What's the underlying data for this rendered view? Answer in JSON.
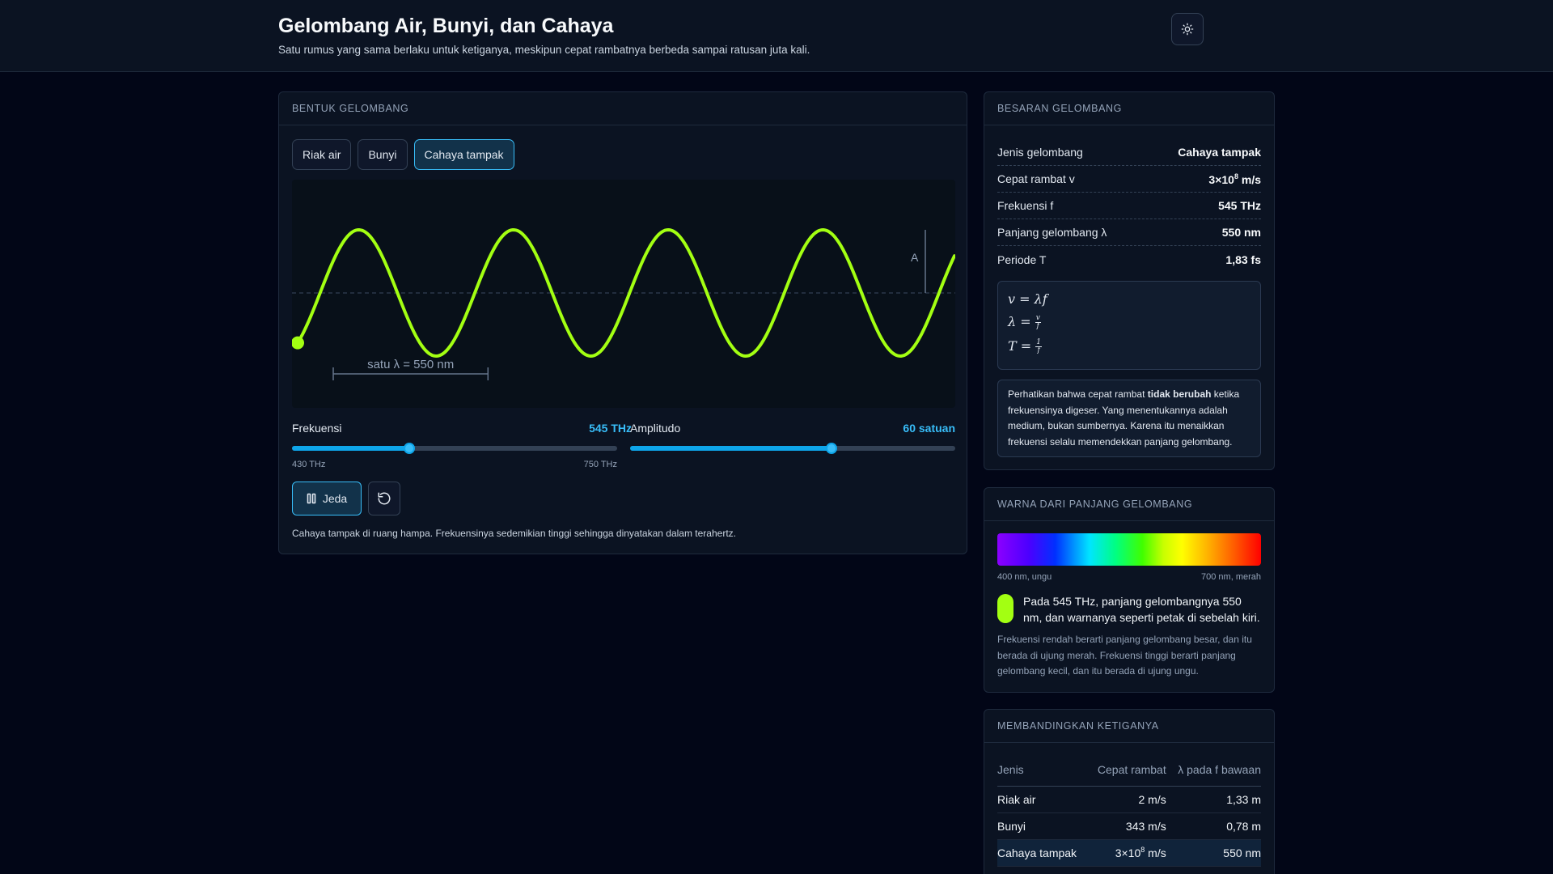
{
  "header": {
    "title": "Gelombang Air, Bunyi, dan Cahaya",
    "subtitle": "Satu rumus yang sama berlaku untuk ketiganya, meskipun cepat rambatnya berbeda sampai ratusan juta kali.",
    "theme_icon": "sun-icon"
  },
  "wave_panel": {
    "heading": "BENTUK GELOMBANG",
    "tabs": [
      {
        "label": "Riak air",
        "active": false
      },
      {
        "label": "Bunyi",
        "active": false
      },
      {
        "label": "Cahaya tampak",
        "active": true
      }
    ],
    "canvas": {
      "wave_color": "#a3ff12",
      "cycles_visible": 4.25,
      "wavelength_label": "satu λ = 550 nm",
      "amplitude_label": "A"
    },
    "frequency": {
      "label": "Frekuensi",
      "value": "545 THz",
      "min": "430 THz",
      "max": "750 THz",
      "fraction": 0.36
    },
    "amplitude": {
      "label": "Amplitudo",
      "value": "60 satuan",
      "fraction": 0.62
    },
    "pause_label": "Jeda",
    "pause_icon": "pause-icon",
    "reset_icon": "reset-icon",
    "caption": "Cahaya tampak di ruang hampa. Frekuensinya sedemikian tinggi sehingga dinyatakan dalam terahertz."
  },
  "properties": {
    "heading": "BESARAN GELOMBANG",
    "rows": [
      {
        "key": "Jenis gelombang",
        "value": "Cahaya tampak"
      },
      {
        "key": "Cepat rambat v",
        "value_base": "3×10",
        "value_exp": "8",
        "value_unit": " m/s"
      },
      {
        "key": "Frekuensi f",
        "value": "545 THz"
      },
      {
        "key": "Panjang gelombang λ",
        "value": "550 nm"
      },
      {
        "key": "Periode T",
        "value": "1,83 fs"
      }
    ],
    "formulas": {
      "f1": "v = λf",
      "f2_lhs": "λ = ",
      "f2_num": "v",
      "f2_den": "f",
      "f3_lhs": "T = ",
      "f3_num": "1",
      "f3_den": "f"
    },
    "note_pre": "Perhatikan bahwa cepat rambat ",
    "note_bold": "tidak berubah",
    "note_post": " ketika frekuensinya digeser. Yang menentukannya adalah medium, bukan sumbernya. Karena itu menaikkan frekuensi selalu memendekkan panjang gelombang."
  },
  "color_panel": {
    "heading": "WARNA DARI PANJANG GELOMBANG",
    "min_label": "400 nm, ungu",
    "max_label": "700 nm, merah",
    "swatch_color": "#a3ff12",
    "text": "Pada 545 THz, panjang gelombangnya 550 nm, dan warnanya seperti petak di sebelah kiri.",
    "note": "Frekuensi rendah berarti panjang gelombang besar, dan itu berada di ujung merah. Frekuensi tinggi berarti panjang gelombang kecil, dan itu berada di ujung ungu."
  },
  "compare": {
    "heading": "MEMBANDINGKAN KETIGANYA",
    "headers": [
      "Jenis",
      "Cepat rambat",
      "λ pada f bawaan"
    ],
    "rows": [
      {
        "jenis": "Riak air",
        "v": "2 m/s",
        "lambda": "1,33 m"
      },
      {
        "jenis": "Bunyi",
        "v": "343 m/s",
        "lambda": "0,78 m"
      },
      {
        "jenis": "Cahaya tampak",
        "v_base": "3×10",
        "v_exp": "8",
        "v_unit": " m/s",
        "lambda": "550 nm",
        "highlight": true
      }
    ]
  }
}
